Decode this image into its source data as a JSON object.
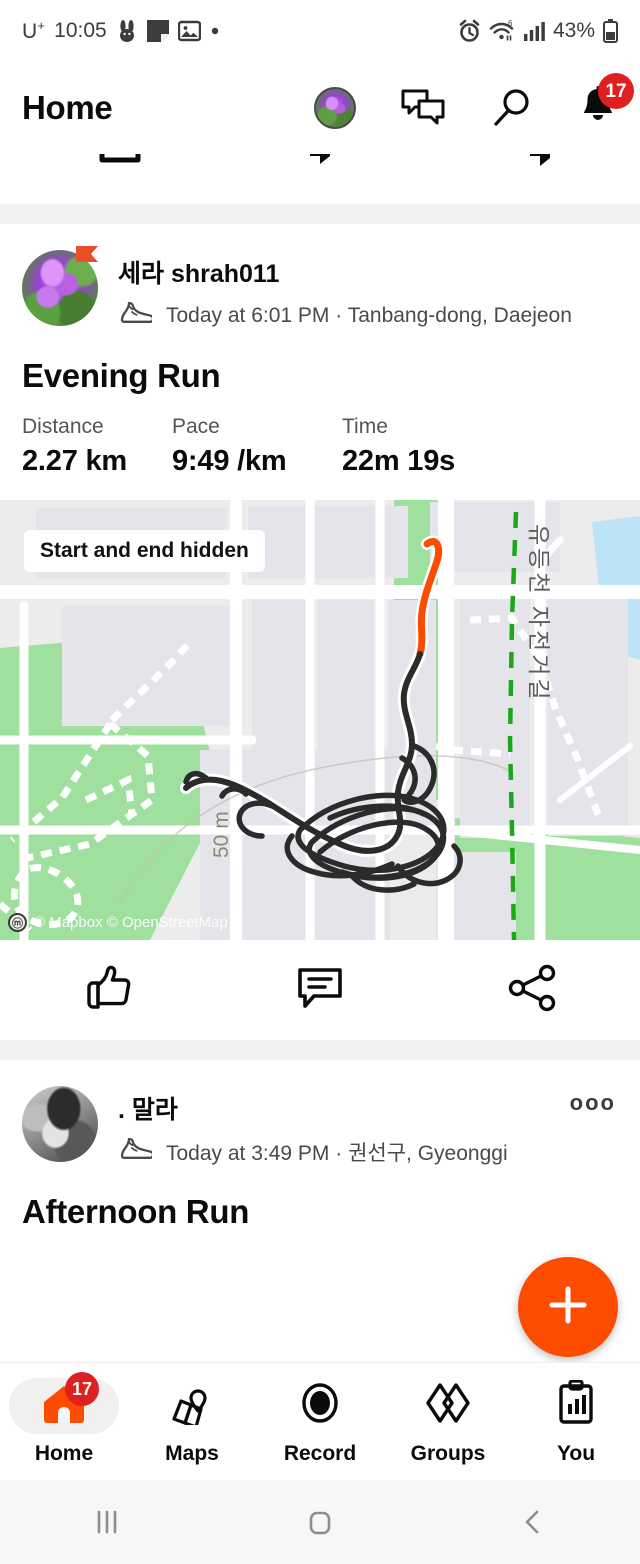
{
  "status_bar": {
    "carrier": "U",
    "carrier_sup": "+",
    "time": "10:05",
    "battery": "43%",
    "icons": [
      "rabbit-icon",
      "note-icon",
      "photo-icon",
      "dot-icon",
      "alarm-icon",
      "wifi-icon",
      "signal-icon",
      "battery-icon"
    ]
  },
  "header": {
    "title": "Home",
    "notification_badge": "17"
  },
  "feed": {
    "posts": [
      {
        "name": "세라 shrah011",
        "subtitle": "Today at 6:01 PM · Tanbang-dong, Daejeon",
        "activity_title": "Evening Run",
        "stats": [
          {
            "label": "Distance",
            "value": "2.27 km"
          },
          {
            "label": "Pace",
            "value": "9:49 /km"
          },
          {
            "label": "Time",
            "value": "22m 19s"
          }
        ],
        "map": {
          "chip": "Start and end hidden",
          "attribution": "© Mapbox © OpenStreetMap",
          "scale_label": "50 m",
          "path_label": "유등천 자전거길",
          "route_color_highlight": "#fc4c02",
          "route_color": "#2b2b2b",
          "land_color": "#ececed",
          "park_color": "#9fe09f",
          "water_color": "#bde3f7",
          "road_color": "#ffffff"
        },
        "actions": [
          "thumbs-up-icon",
          "comment-icon",
          "share-icon"
        ]
      },
      {
        "name": ". 말라",
        "subtitle": "Today at 3:49 PM · 권선구, Gyeonggi",
        "activity_title": "Afternoon Run",
        "more_menu": "ooo"
      }
    ]
  },
  "fab": {
    "label": "+",
    "color": "#fc4c02"
  },
  "bottom_nav": {
    "items": [
      {
        "label": "Home",
        "icon": "home-icon",
        "active": true,
        "badge": "17"
      },
      {
        "label": "Maps",
        "icon": "maps-icon",
        "active": false,
        "badge": ""
      },
      {
        "label": "Record",
        "icon": "record-icon",
        "active": false,
        "badge": ""
      },
      {
        "label": "Groups",
        "icon": "groups-icon",
        "active": false,
        "badge": ""
      },
      {
        "label": "You",
        "icon": "you-icon",
        "active": false,
        "badge": ""
      }
    ]
  },
  "android_nav": {
    "items": [
      "recents-icon",
      "home-icon",
      "back-icon"
    ]
  }
}
